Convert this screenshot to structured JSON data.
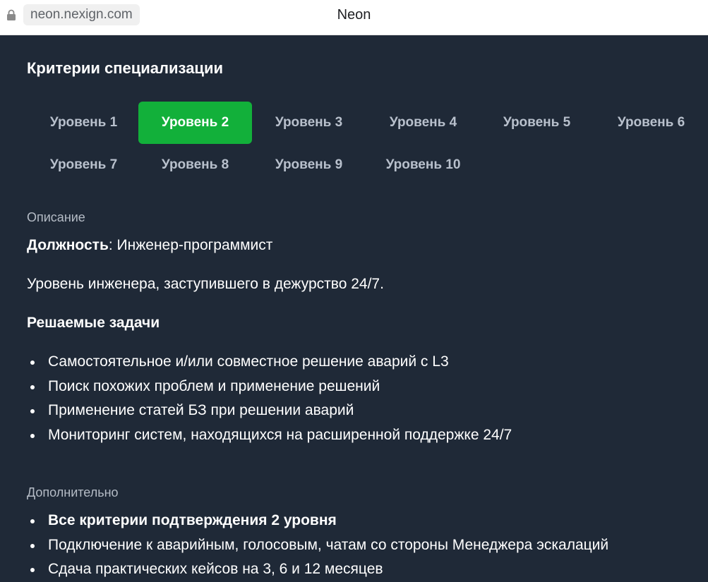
{
  "browser": {
    "url": "neon.nexign.com",
    "tab_title": "Neon"
  },
  "page": {
    "title": "Критерии специализации",
    "levels": [
      {
        "label": "Уровень 1",
        "active": false
      },
      {
        "label": "Уровень 2",
        "active": true
      },
      {
        "label": "Уровень 3",
        "active": false
      },
      {
        "label": "Уровень 4",
        "active": false
      },
      {
        "label": "Уровень 5",
        "active": false
      },
      {
        "label": "Уровень 6",
        "active": false
      },
      {
        "label": "Уровень 7",
        "active": false
      },
      {
        "label": "Уровень 8",
        "active": false
      },
      {
        "label": "Уровень 9",
        "active": false
      },
      {
        "label": "Уровень 10",
        "active": false
      }
    ],
    "description": {
      "label": "Описание",
      "position_label": "Должность",
      "position_value": ": Инженер-программист",
      "summary": "Уровень инженера, заступившего в дежурство 24/7.",
      "tasks_title": "Решаемые задачи",
      "tasks": [
        "Самостоятельное и/или совместное решение аварий с L3",
        "Поиск похожих проблем и применение решений",
        "Применение статей БЗ при решении аварий",
        "Мониторинг систем, находящихся на расширенной поддержке 24/7"
      ]
    },
    "additional": {
      "label": "Дополнительно",
      "items": [
        {
          "text": "Все критерии подтверждения 2 уровня",
          "bold": true
        },
        {
          "text": "Подключение к аварийным, голосовым, чатам со стороны Менеджера эскалаций",
          "bold": false
        },
        {
          "text": "Сдача практических кейсов на 3, 6 и 12 месяцев",
          "bold": false
        }
      ]
    }
  },
  "colors": {
    "background": "#1f2937",
    "accent": "#12b03a",
    "muted_text": "#b5bcc6"
  }
}
